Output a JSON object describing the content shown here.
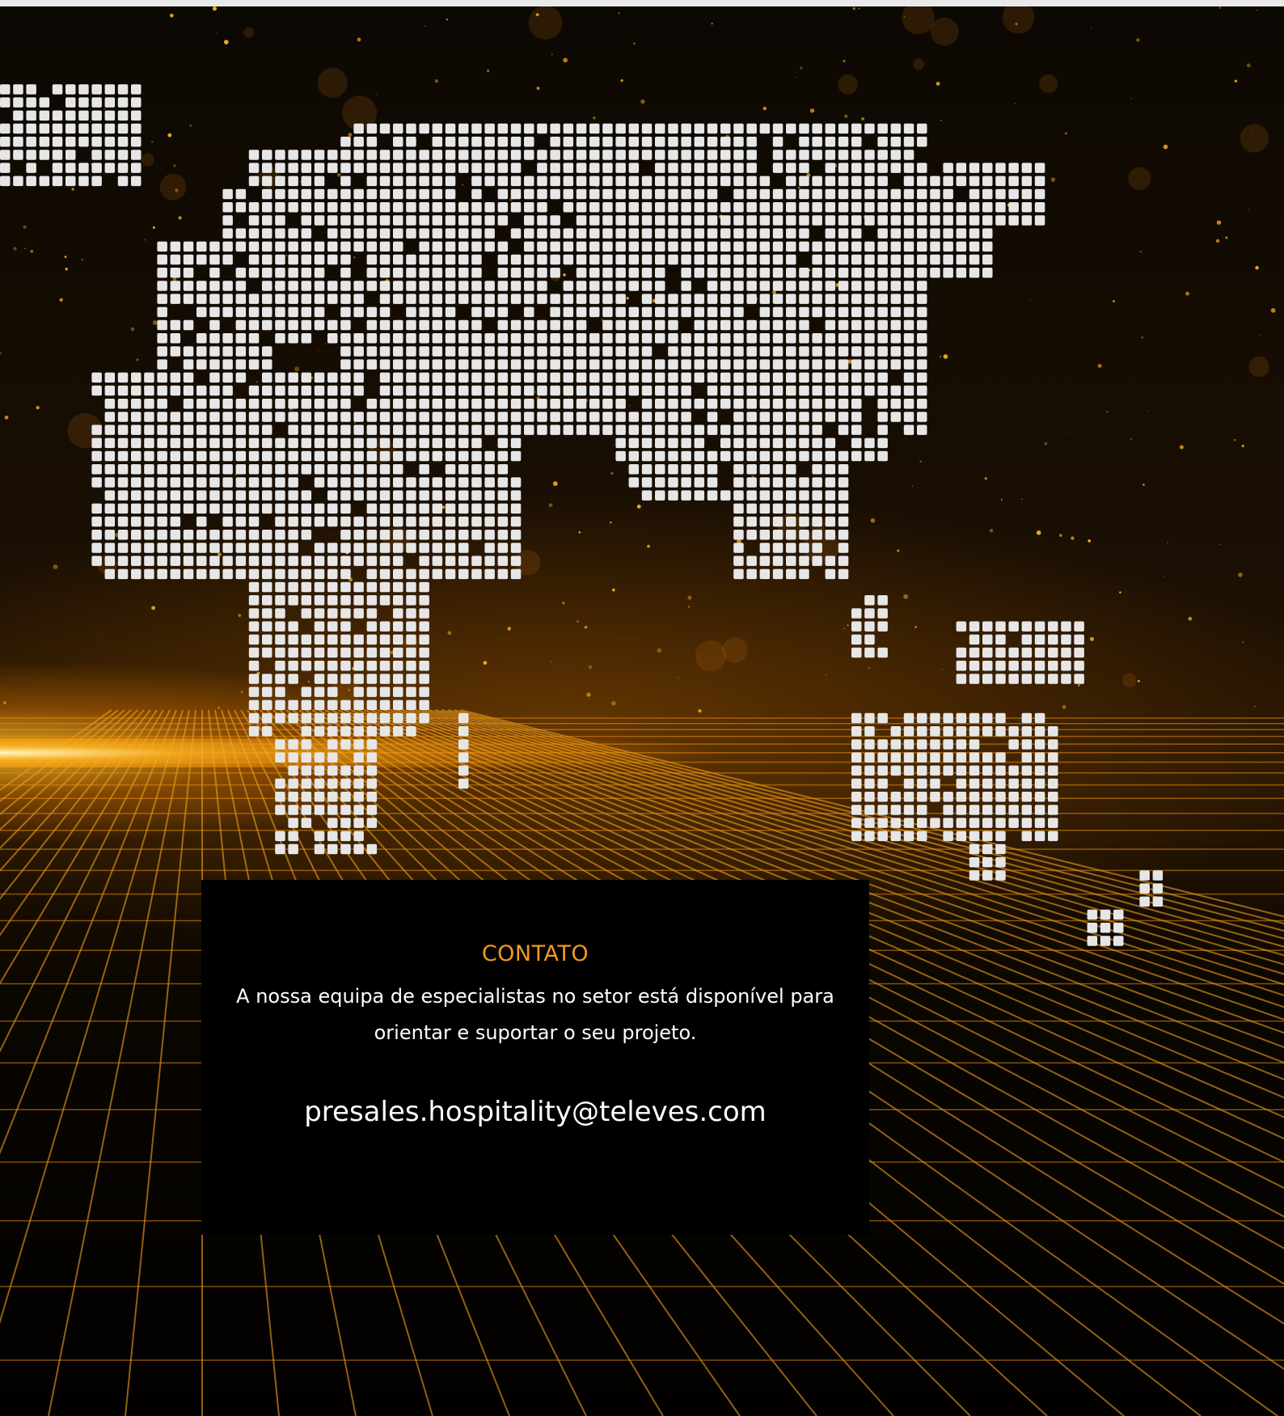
{
  "colors": {
    "accent": "#f29a1d",
    "card_background": "#000000",
    "text": "#ffffff",
    "map_dots": "#e6e6e6",
    "grid_glow": "#ffb21e"
  },
  "background": {
    "icon": "dotted-world-map-icon"
  },
  "contact": {
    "title": "CONTATO",
    "description": "A nossa equipa de especialistas no setor está disponível para orientar e suportar o seu projeto.",
    "email": "presales.hospitality@televes.com"
  }
}
